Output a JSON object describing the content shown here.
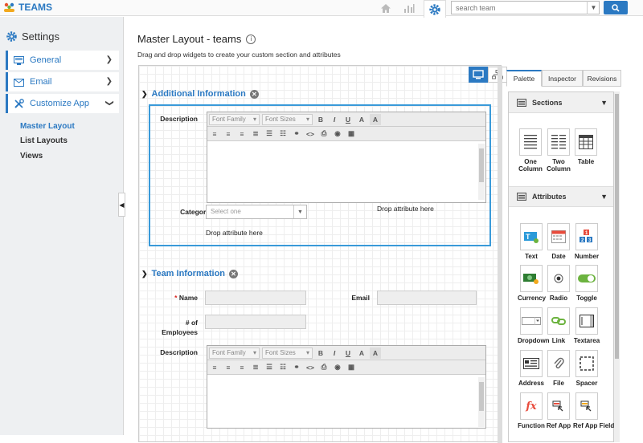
{
  "app": {
    "name": "TEAMS"
  },
  "topbar": {
    "search_placeholder": "search team"
  },
  "sidebar": {
    "title": "Settings",
    "items": [
      {
        "label": "General"
      },
      {
        "label": "Email"
      },
      {
        "label": "Customize App"
      }
    ],
    "subitems": [
      {
        "label": "Master Layout",
        "active": true
      },
      {
        "label": "List Layouts"
      },
      {
        "label": "Views"
      }
    ]
  },
  "page": {
    "title": "Master Layout - teams",
    "subtitle": "Drag and drop widgets to create your custom section and attributes"
  },
  "sections": [
    {
      "title": "Additional Information",
      "description_label": "Description",
      "category_label": "Category",
      "category_placeholder": "Select one",
      "drop_text_1": "Drop attribute here",
      "drop_text_2": "Drop attribute here"
    },
    {
      "title": "Team Information",
      "name_label": "Name",
      "email_label": "Email",
      "employees_label_1": "# of",
      "employees_label_2": "Employees",
      "description_label": "Description"
    }
  ],
  "editor": {
    "font_family": "Font Family",
    "font_sizes": "Font Sizes"
  },
  "colors": {
    "accent": "#2b79c2",
    "section_border": "#3a9ad9",
    "required": "#d9231d"
  },
  "panel": {
    "tabs": [
      "Palette",
      "Inspector",
      "Revisions"
    ],
    "sections_title": "Sections",
    "attributes_title": "Attributes",
    "section_widgets": [
      {
        "line1": "One",
        "line2": "Column",
        "icon": "one-column-icon"
      },
      {
        "line1": "Two",
        "line2": "Column",
        "icon": "two-column-icon"
      },
      {
        "line1": "Table",
        "line2": "",
        "icon": "table-icon"
      }
    ],
    "attribute_widgets": [
      {
        "label": "Text",
        "icon": "text-icon"
      },
      {
        "label": "Date",
        "icon": "calendar-icon"
      },
      {
        "label": "Number",
        "icon": "number-icon"
      },
      {
        "label": "Currency",
        "icon": "currency-icon"
      },
      {
        "label": "Radio",
        "icon": "radio-icon"
      },
      {
        "label": "Toggle",
        "icon": "toggle-icon"
      },
      {
        "label": "Dropdown",
        "icon": "dropdown-icon"
      },
      {
        "label": "Link",
        "icon": "link-icon"
      },
      {
        "label": "Textarea",
        "icon": "textarea-icon"
      },
      {
        "label": "Address",
        "icon": "address-icon"
      },
      {
        "label": "File",
        "icon": "paperclip-icon"
      },
      {
        "label": "Spacer",
        "icon": "spacer-icon"
      },
      {
        "label": "Function",
        "icon": "function-icon"
      },
      {
        "label": "Ref App",
        "icon": "ref-app-icon"
      },
      {
        "label": "Ref App Field",
        "icon": "ref-app-field-icon"
      }
    ]
  }
}
